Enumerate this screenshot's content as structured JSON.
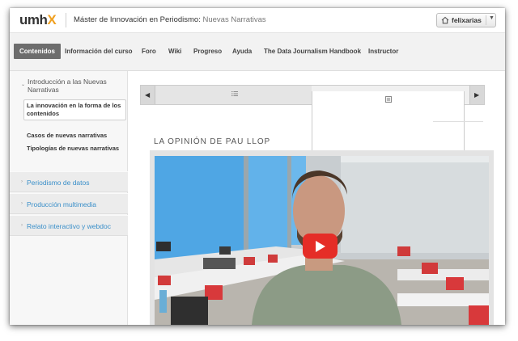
{
  "header": {
    "logo_text": "umh",
    "logo_accent": "X",
    "course_title": "Máster de Innovación en Periodismo:",
    "course_subtitle": "Nuevas Narrativas",
    "user_name": "felixarias",
    "user_icon": "home-icon",
    "menu_icon": "caret-down-icon"
  },
  "nav": {
    "tabs": [
      {
        "label": "Contenidos",
        "active": true
      },
      {
        "label": "Información del curso",
        "active": false
      },
      {
        "label": "Foro",
        "active": false
      },
      {
        "label": "Wiki",
        "active": false
      },
      {
        "label": "Progreso",
        "active": false
      },
      {
        "label": "Ayuda",
        "active": false
      },
      {
        "label": "The Data Journalism Handbook",
        "active": false
      },
      {
        "label": "Instructor",
        "active": false
      }
    ]
  },
  "sidebar": {
    "open_chapter": "Introducción a las Nuevas Narrativas",
    "subsections": [
      {
        "label": "La innovación en la forma de los contenidos",
        "current": true
      },
      {
        "label": "Casos de nuevas narrativas",
        "current": false
      },
      {
        "label": "Tipologías de nuevas narrativas",
        "current": false
      }
    ],
    "chapters": [
      {
        "label": "Periodismo de datos"
      },
      {
        "label": "Producción multimedia"
      },
      {
        "label": "Relato interactivo y webdoc"
      }
    ]
  },
  "sequence": {
    "prev_icon": "arrow-left-icon",
    "next_icon": "arrow-right-icon",
    "items": [
      {
        "type": "list",
        "icon": "list-icon"
      },
      {
        "type": "video",
        "icon": "video-icon",
        "active": true
      }
    ]
  },
  "unit": {
    "title": "LA OPINIÓN DE PAU LLOP"
  },
  "video": {
    "play_icon": "youtube-play-icon"
  },
  "colors": {
    "accent": "#f0a020",
    "link": "#3a8fc9",
    "active_tab": "#6d6d6d",
    "play_button": "#e52d27"
  }
}
